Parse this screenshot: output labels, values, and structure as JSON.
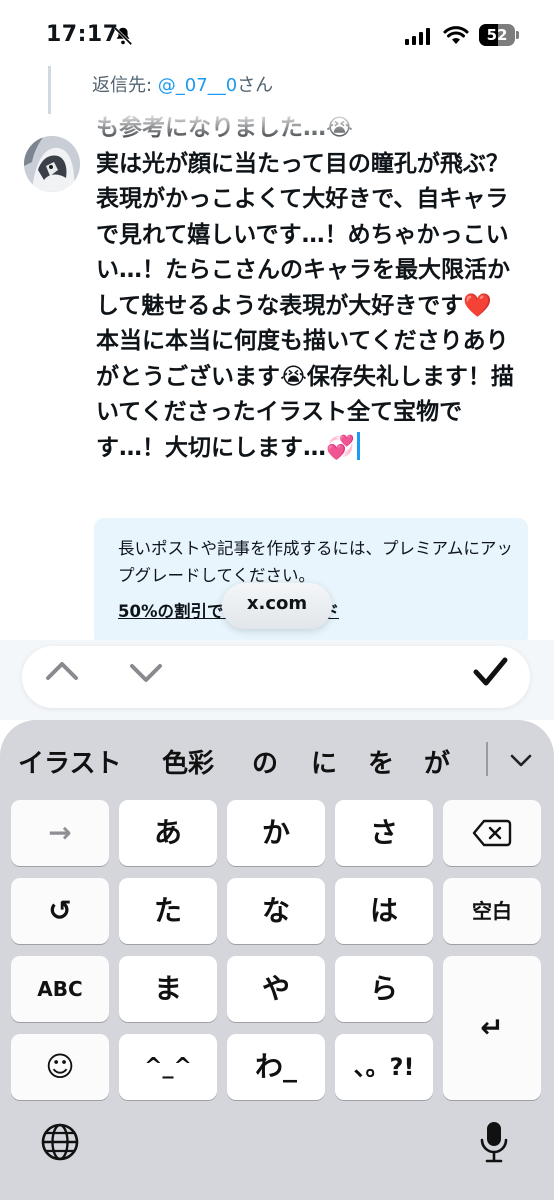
{
  "status_bar": {
    "time": "17:17",
    "battery_level": "52",
    "battery_fraction": 0.52,
    "icons": [
      "bell-slash-icon",
      "signal-icon",
      "wifi-icon",
      "battery-icon"
    ]
  },
  "reply": {
    "prefix": "返信先: ",
    "handle": "@_07__0",
    "suffix": "さん"
  },
  "post": {
    "lines": [
      "も参考になりました…😭",
      "実は光が顔に当たって目の瞳孔が飛ぶ？表現がかっこよくて大好きで、自キャラで見れて嬉しいです…！めちゃかっこいい…！たらこさんのキャラを最大限活かして魅せるような表現が大好きです❤️",
      "本当に本当に何度も描いてくださりありがとうございます😭保存失礼します！描いてくださったイラスト全て宝物です…！大切にします…💞"
    ]
  },
  "premium": {
    "message": "長いポストや記事を作成するには、プレミアムにアップグレードしてください。",
    "link": "50%の割引でアップグレード",
    "url_pill": "x.com"
  },
  "toolbar": {
    "prev_icon": "chevron-up-icon",
    "next_icon": "chevron-down-icon",
    "done_icon": "checkmark-icon"
  },
  "keyboard": {
    "candidates": [
      "イラスト",
      "色彩",
      "の",
      "に",
      "を",
      "が"
    ],
    "rows": [
      [
        "→",
        "あ",
        "か",
        "さ",
        "⌫"
      ],
      [
        "↺",
        "た",
        "な",
        "は",
        "空白"
      ],
      [
        "ABC",
        "ま",
        "や",
        "ら",
        "↵"
      ],
      [
        "☺",
        "^_^",
        "わ_",
        "、。?!"
      ]
    ],
    "globe_icon": "globe-icon",
    "mic_icon": "microphone-icon"
  },
  "colors": {
    "accent": "#1d9bf0",
    "banner_bg": "#e8f5fd",
    "keyboard_bg": "#d4d6dc",
    "heart": "#e0245e"
  }
}
